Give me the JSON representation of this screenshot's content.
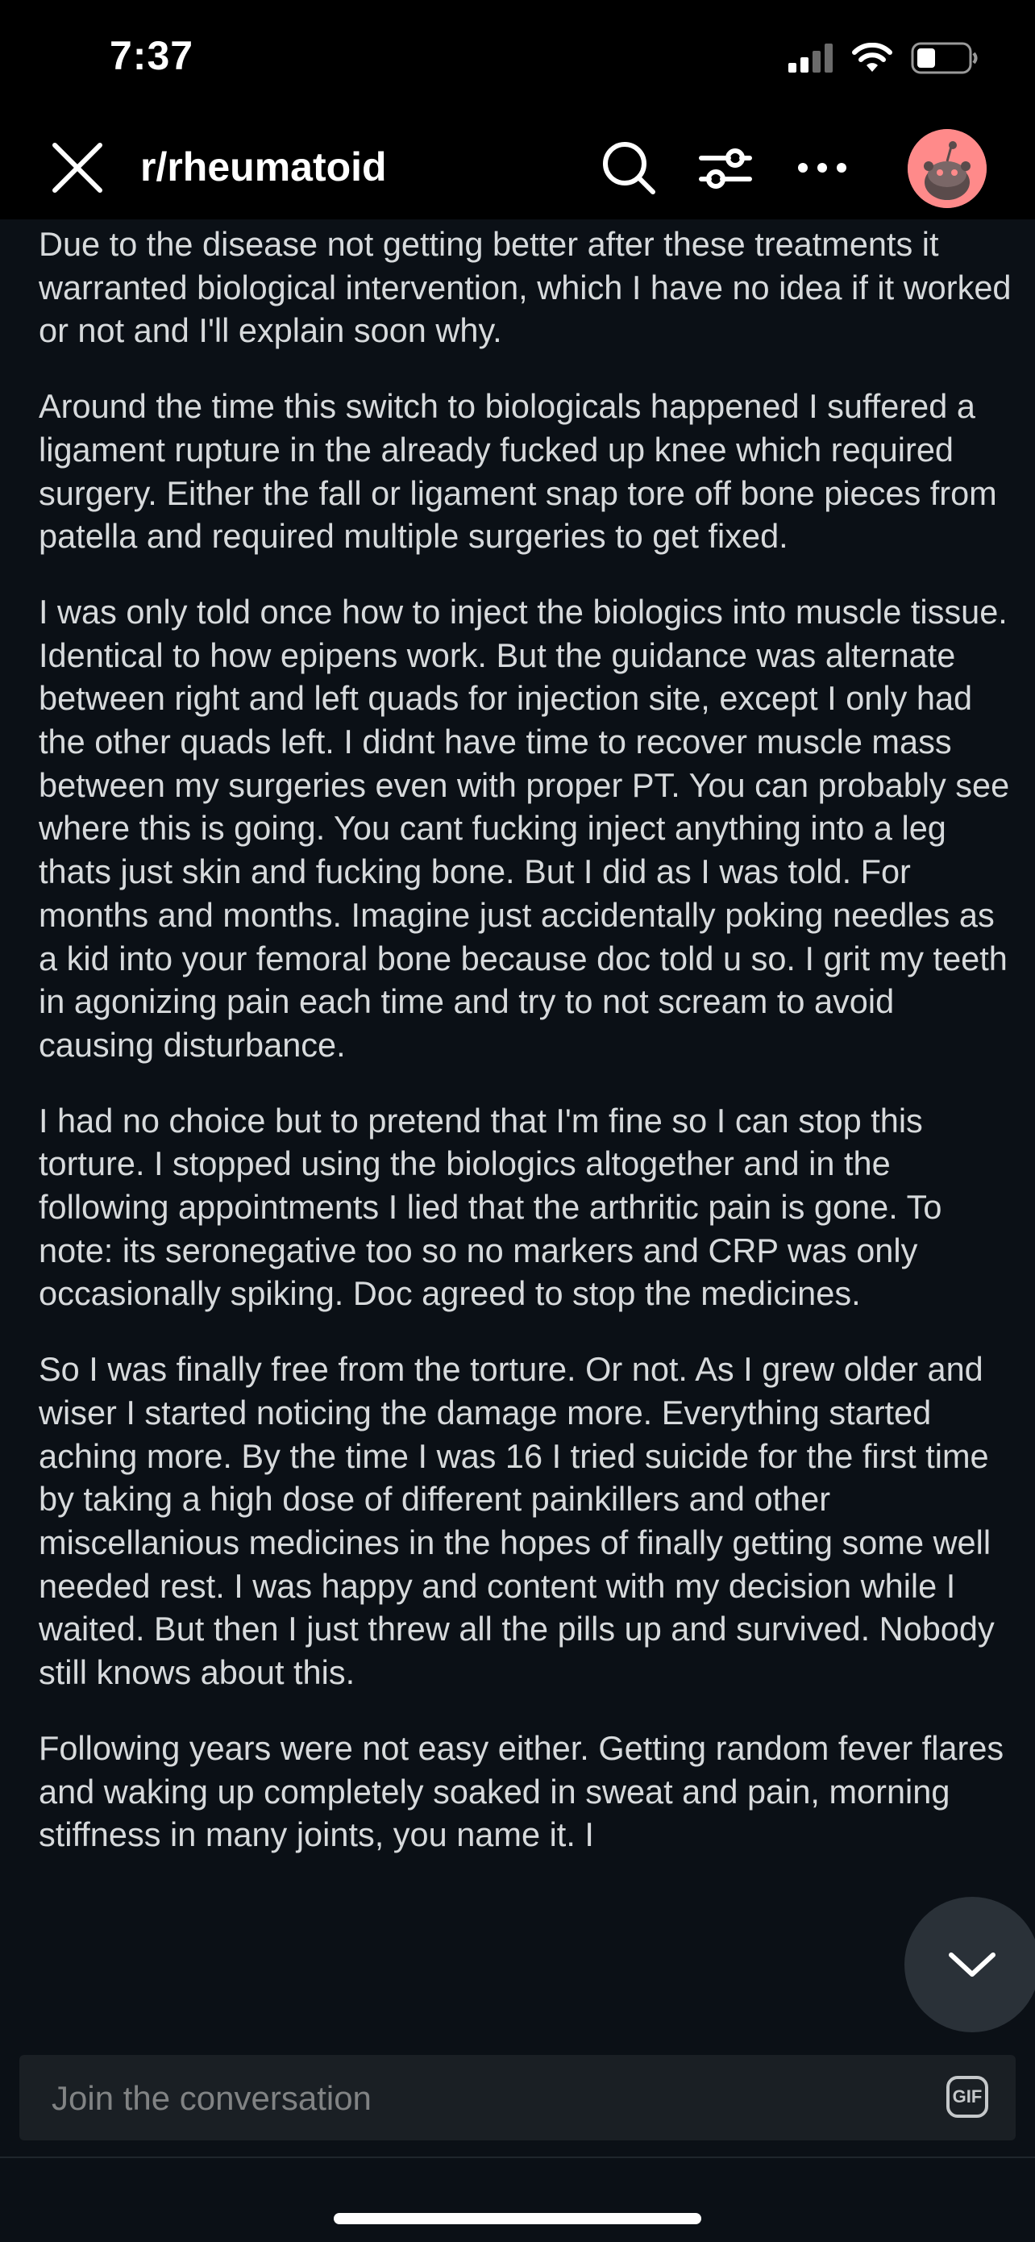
{
  "status_bar": {
    "time": "7:37"
  },
  "header": {
    "subreddit": "r/rheumatoid",
    "icons": [
      "close-icon",
      "search-icon",
      "filter-icon",
      "more-icon",
      "avatar"
    ]
  },
  "post": {
    "paragraphs": [
      "Due to the disease not getting better after these treatments it warranted biological intervention, which I have no idea if it worked or not and I'll explain soon why.",
      "Around the time this switch to biologicals happened I suffered a ligament rupture in the already fucked up knee which required surgery. Either the fall or ligament snap tore off bone pieces from patella and required multiple surgeries to get fixed.",
      "I was only told once how to inject the biologics into muscle tissue. Identical to how epipens work. But the guidance was alternate between right and left quads for injection site, except I only had the other quads left. I didnt have time to recover muscle mass between my surgeries even with proper PT. You can probably see where this is going. You cant fucking inject anything into a leg thats just skin and fucking bone. But I did as I was told. For months and months. Imagine just accidentally poking needles as a kid into your femoral bone because doc told u so. I grit my teeth in agonizing pain each time and try to not scream to avoid causing disturbance.",
      "I had no choice but to pretend that I'm fine so I can stop this torture. I stopped using the biologics altogether and in the following appointments I lied that the arthritic pain is gone. To note: its seronegative too so no markers and CRP was only occasionally spiking. Doc agreed to stop the medicines.",
      "So I was finally free from the torture. Or not. As I grew older and wiser I started noticing the damage more. Everything started aching more. By the time I was 16 I tried suicide for the first time by taking a high dose of different painkillers and other miscellanious medicines in the hopes of finally getting some well needed rest. I was happy and content with my decision while I waited. But then I just threw all the pills up and survived. Nobody still knows about this.",
      "Following years were not easy either. Getting random fever flares and waking up completely soaked in sweat and pain, morning stiffness in many joints, you name it. I"
    ]
  },
  "composer": {
    "placeholder": "Join the conversation",
    "gif_label": "GIF"
  }
}
